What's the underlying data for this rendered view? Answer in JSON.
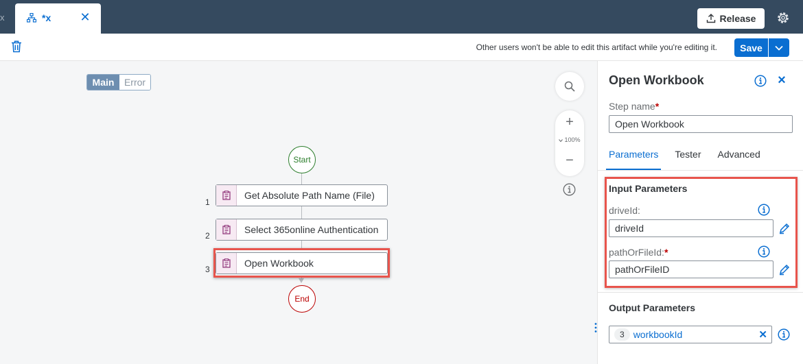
{
  "tab": {
    "title": "*x",
    "edge_glyph": "x",
    "close_glyph": "✕",
    "icon": "hierarchy-icon"
  },
  "header": {
    "release_label": "Release",
    "release_icon": "upload-icon",
    "settings_icon": "gear-icon"
  },
  "toolbar": {
    "delete_icon": "trash-icon",
    "lock_message": "Other users won't be able to edit this artifact while you're editing it.",
    "save_label": "Save"
  },
  "canvas": {
    "view_tabs": [
      {
        "label": "Main",
        "selected": true
      },
      {
        "label": "Error",
        "selected": false
      }
    ],
    "zoom": {
      "plus": "+",
      "level": "100%",
      "minus": "−"
    },
    "start_label": "Start",
    "end_label": "End",
    "steps": [
      {
        "number": "1",
        "label": "Get Absolute Path Name (File)"
      },
      {
        "number": "2",
        "label": "Select 365online Authentication"
      },
      {
        "number": "3",
        "label": "Open Workbook"
      }
    ],
    "selected_step": "3"
  },
  "panel": {
    "title": "Open Workbook",
    "step_name_label": "Step name",
    "required_mark": "*",
    "step_name_value": "Open Workbook",
    "tabs": [
      {
        "label": "Parameters",
        "active": true
      },
      {
        "label": "Tester",
        "active": false
      },
      {
        "label": "Advanced",
        "active": false
      }
    ],
    "input_params_title": "Input Parameters",
    "params": [
      {
        "label": "driveId:",
        "required": false,
        "value": "driveId"
      },
      {
        "label": "pathOrFileId:",
        "required": true,
        "value": "pathOrFileID"
      }
    ],
    "output_params_title": "Output Parameters",
    "output": {
      "badge": "3",
      "name": "workbookId",
      "remove_glyph": "✕"
    }
  },
  "colors": {
    "header": "#354a5f",
    "accent": "#0a6ed1",
    "highlight": "#e8544c",
    "start": "#2b7d2b",
    "end": "#bb0000"
  }
}
